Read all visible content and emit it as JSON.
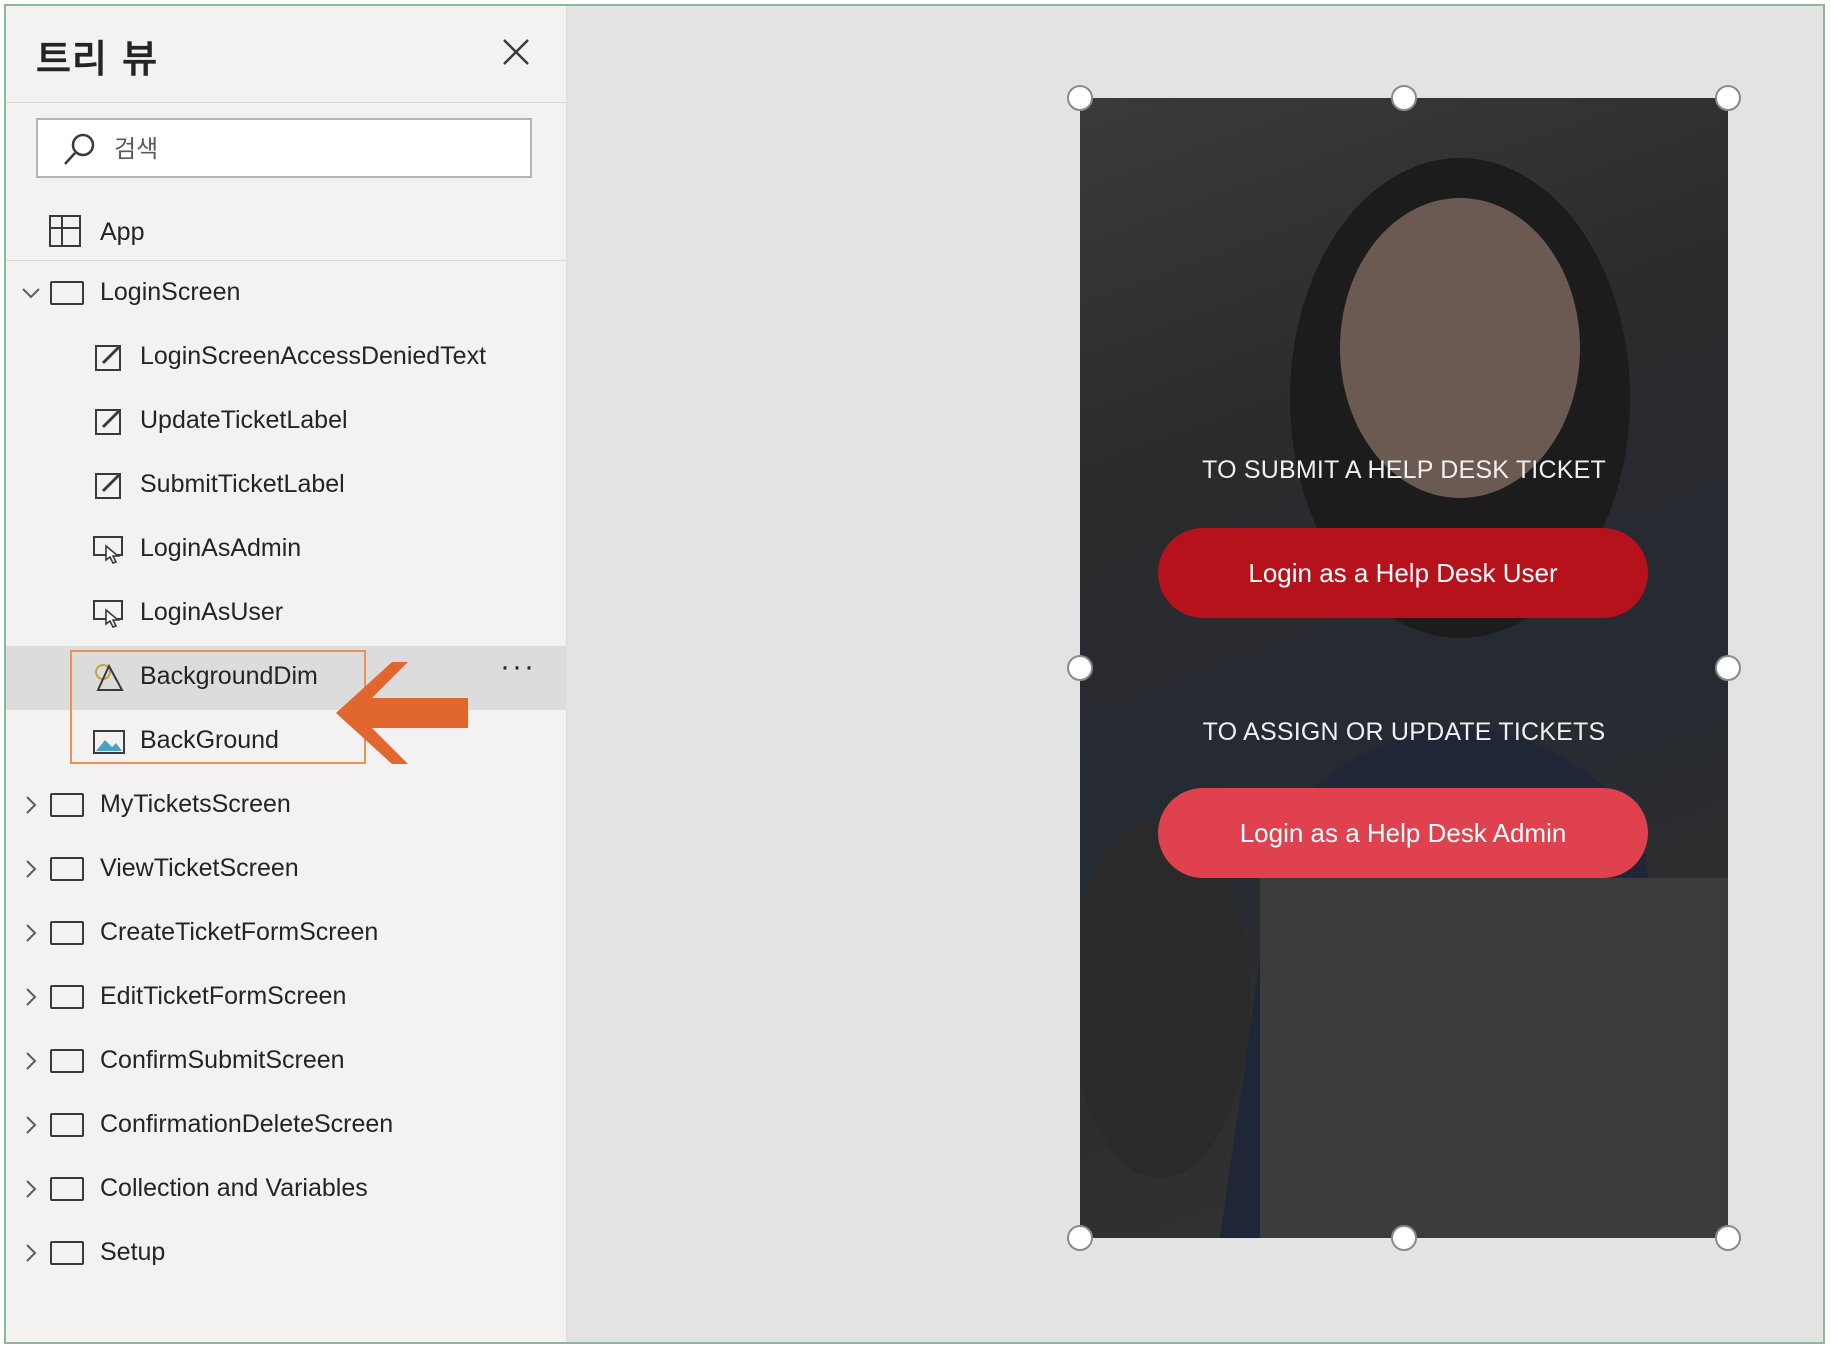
{
  "tree": {
    "title": "트리 뷰",
    "search_placeholder": "검색",
    "app_label": "App",
    "login_screen": {
      "label": "LoginScreen",
      "children": [
        {
          "label": "LoginScreenAccessDeniedText",
          "icon": "edit-text-icon"
        },
        {
          "label": "UpdateTicketLabel",
          "icon": "edit-text-icon"
        },
        {
          "label": "SubmitTicketLabel",
          "icon": "edit-text-icon"
        },
        {
          "label": "LoginAsAdmin",
          "icon": "button-icon"
        },
        {
          "label": "LoginAsUser",
          "icon": "button-icon"
        },
        {
          "label": "BackgroundDim",
          "icon": "shape-icon"
        },
        {
          "label": "BackGround",
          "icon": "image-icon"
        }
      ]
    },
    "screens": [
      "MyTicketsScreen",
      "ViewTicketScreen",
      "CreateTicketFormScreen",
      "EditTicketFormScreen",
      "ConfirmSubmitScreen",
      "ConfirmationDeleteScreen",
      "Collection and Variables",
      "Setup"
    ],
    "more_label": "···"
  },
  "phone": {
    "submit_prompt": "TO SUBMIT A HELP DESK TICKET",
    "user_button": "Login as a Help Desk User",
    "assign_prompt": "TO ASSIGN OR UPDATE TICKETS",
    "admin_button": "Login as a Help Desk Admin"
  },
  "colors": {
    "user_button": "#b5121b",
    "admin_button": "#e0414e",
    "highlight": "#e8925a",
    "arrow": "#e2672f"
  }
}
